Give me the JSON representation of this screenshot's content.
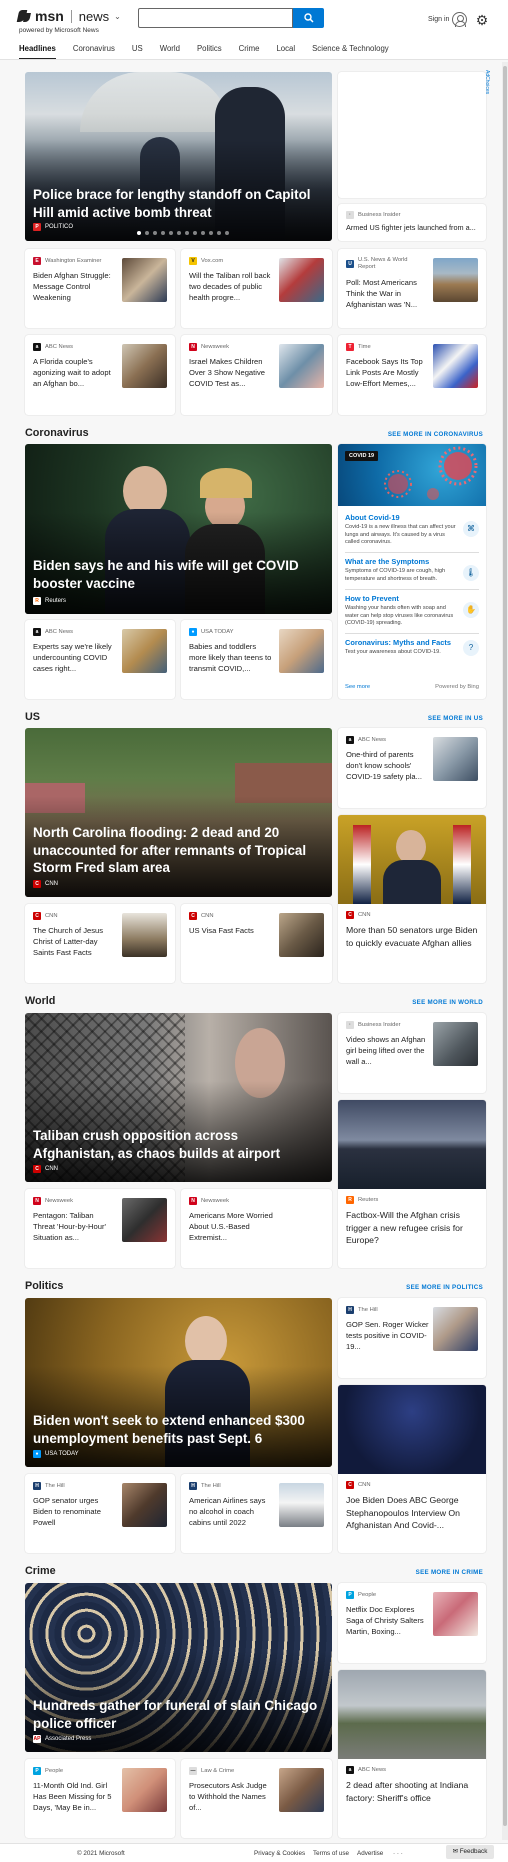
{
  "header": {
    "brand": "msn",
    "section": "news",
    "powered_by": "powered by Microsoft News",
    "search_placeholder": "",
    "sign_in": "Sign in"
  },
  "nav": [
    "Headlines",
    "Coronavirus",
    "US",
    "World",
    "Politics",
    "Crime",
    "Local",
    "Science & Technology"
  ],
  "adchoices": "AdChoices",
  "headlines": {
    "hero": {
      "title": "Police brace for lengthy standoff on Capitol Hill amid active bomb threat",
      "source": "POLITICO",
      "slide_count": 12,
      "active_slide": 1
    },
    "right_top": {
      "source": "Business Insider",
      "title": "Armed US fighter jets launched from a..."
    },
    "row1": [
      {
        "source": "Washington Examiner",
        "title": "Biden Afghan Struggle: Message Control Weakening"
      },
      {
        "source": "Vox.com",
        "title": "Will the Taliban roll back two decades of public health progre..."
      },
      {
        "source": "U.S. News & World Report",
        "title": "Poll: Most Americans Think the War in Afghanistan was 'N..."
      }
    ],
    "row2": [
      {
        "source": "ABC News",
        "title": "A Florida couple's agonizing wait to adopt an Afghan bo..."
      },
      {
        "source": "Newsweek",
        "title": "Israel Makes Children Over 3 Show Negative COVID Test as..."
      },
      {
        "source": "Time",
        "title": "Facebook Says Its Top Link Posts Are Mostly Low-Effort Memes,..."
      }
    ]
  },
  "coronavirus": {
    "heading": "Coronavirus",
    "more": "SEE MORE IN CORONAVIRUS",
    "hero": {
      "title": "Biden says he and his wife will get COVID booster vaccine",
      "source": "Reuters"
    },
    "small": [
      {
        "source": "ABC News",
        "title": "Experts say we're likely undercounting COVID cases right..."
      },
      {
        "source": "USA TODAY",
        "title": "Babies and toddlers more likely than teens to transmit COVID,..."
      }
    ],
    "panel": {
      "badge": "COVID 19",
      "items": [
        {
          "title": "About Covid-19",
          "text": "Covid-19 is a new illness that can affect your lungs and airways. It's caused by a virus called coronavirus."
        },
        {
          "title": "What are the Symptoms",
          "text": "Symptoms of COVID-19 are cough, high temperature and shortness of breath."
        },
        {
          "title": "How to Prevent",
          "text": "Washing your hands often with soap and water can help stop viruses like coronavirus (COVID-19) spreading."
        },
        {
          "title": "Coronavirus: Myths and Facts",
          "text": "Test your awareness about COVID-19."
        }
      ],
      "see_more": "See more",
      "powered": "Powered by Bing"
    }
  },
  "us": {
    "heading": "US",
    "more": "SEE MORE IN US",
    "hero": {
      "title": "North Carolina flooding: 2 dead and 20 unaccounted for after remnants of Tropical Storm Fred slam area",
      "source": "CNN"
    },
    "right_top": {
      "source": "ABC News",
      "title": "One-third of parents don't know schools' COVID-19 safety pla..."
    },
    "right_big": {
      "source": "CNN",
      "title": "More than 50 senators urge Biden to quickly evacuate Afghan allies"
    },
    "small": [
      {
        "source": "CNN",
        "title": "The Church of Jesus Christ of Latter-day Saints Fast Facts"
      },
      {
        "source": "CNN",
        "title": "US Visa Fast Facts"
      }
    ]
  },
  "world": {
    "heading": "World",
    "more": "SEE MORE IN WORLD",
    "hero": {
      "title": "Taliban crush opposition across Afghanistan, as chaos builds at airport",
      "source": "CNN"
    },
    "right_top": {
      "source": "Business Insider",
      "title": "Video shows an Afghan girl being lifted over the wall a..."
    },
    "right_big": {
      "source": "Reuters",
      "title": "Factbox-Will the Afghan crisis trigger a new refugee crisis for Europe?"
    },
    "small": [
      {
        "source": "Newsweek",
        "title": "Pentagon: Taliban Threat 'Hour-by-Hour' Situation as..."
      },
      {
        "source": "Newsweek",
        "title": "Americans More Worried About U.S.-Based Extremist..."
      }
    ]
  },
  "politics": {
    "heading": "Politics",
    "more": "SEE MORE IN POLITICS",
    "hero": {
      "title": "Biden won't seek to extend enhanced $300 unemployment benefits past Sept. 6",
      "source": "USA TODAY"
    },
    "right_top": {
      "source": "The Hill",
      "title": "GOP Sen. Roger Wicker tests positive in COVID-19..."
    },
    "right_big": {
      "source": "CNN",
      "title": "Joe Biden Does ABC George Stephanopoulos Interview On Afghanistan And Covid-..."
    },
    "small": [
      {
        "source": "The Hill",
        "title": "GOP senator urges Biden to renominate Powell"
      },
      {
        "source": "The Hill",
        "title": "American Airlines says no alcohol in coach cabins until 2022"
      }
    ]
  },
  "crime": {
    "heading": "Crime",
    "more": "SEE MORE IN CRIME",
    "hero": {
      "title": "Hundreds gather for funeral of slain Chicago police officer",
      "source": "Associated Press"
    },
    "right_top": {
      "source": "People",
      "title": "Netflix Doc Explores Saga of Christy Salters Martin, Boxing..."
    },
    "right_big": {
      "source": "ABC News",
      "title": "2 dead after shooting at Indiana factory: Sheriff's office"
    },
    "small": [
      {
        "source": "People",
        "title": "11-Month Old Ind. Girl Has Been Missing for 5 Days, 'May Be in..."
      },
      {
        "source": "Law & Crime",
        "title": "Prosecutors Ask Judge to Withhold the Names of..."
      }
    ]
  },
  "footer": {
    "copyright": "© 2021 Microsoft",
    "privacy": "Privacy & Cookies",
    "terms": "Terms of use",
    "advertise": "Advertise",
    "more": "· · ·",
    "feedback": "Feedback"
  }
}
